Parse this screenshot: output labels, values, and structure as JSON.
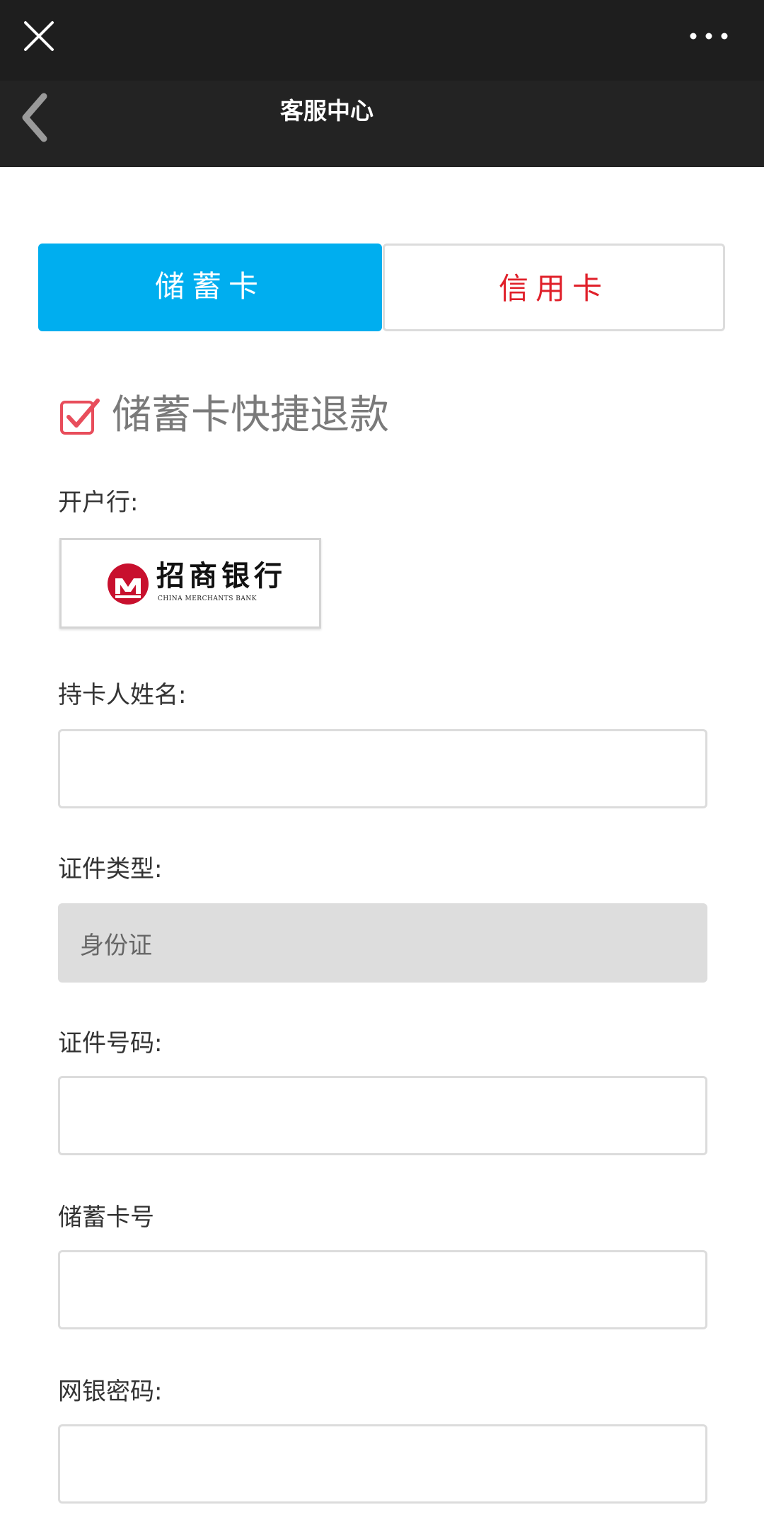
{
  "topbar": {
    "close_icon": "close-icon",
    "more_icon": "more-dots-icon"
  },
  "header": {
    "title": "客服中心",
    "back_icon": "chevron-left-icon"
  },
  "tabs": [
    {
      "label": "储蓄卡",
      "active": true,
      "color": "#00aeef"
    },
    {
      "label": "信用卡",
      "active": false,
      "color": "#e0202a"
    }
  ],
  "section": {
    "title": "储蓄卡快捷退款",
    "icon": "checkbox-checked-icon",
    "icon_color": "#e84d5b"
  },
  "bank": {
    "label": "开户行:",
    "logo_text": "招商银行",
    "logo_subtext": "CHINA MERCHANTS BANK",
    "logo_color": "#c8102e"
  },
  "fields": {
    "holder_name": {
      "label": "持卡人姓名:",
      "value": ""
    },
    "id_type": {
      "label": "证件类型:",
      "value": "身份证"
    },
    "id_number": {
      "label": "证件号码:",
      "value": ""
    },
    "card_number": {
      "label": "储蓄卡号",
      "value": ""
    },
    "password": {
      "label": "网银密码:",
      "value": ""
    }
  }
}
